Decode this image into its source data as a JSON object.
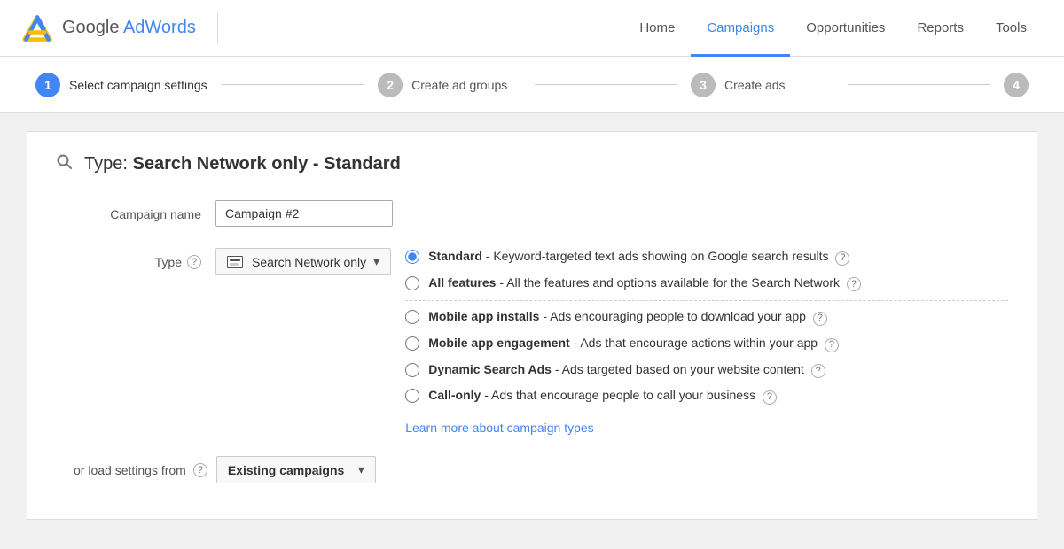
{
  "header": {
    "logo_text_regular": "Google ",
    "logo_text_blue": "AdWords",
    "nav_items": [
      {
        "id": "home",
        "label": "Home",
        "active": false
      },
      {
        "id": "campaigns",
        "label": "Campaigns",
        "active": true
      },
      {
        "id": "opportunities",
        "label": "Opportunities",
        "active": false
      },
      {
        "id": "reports",
        "label": "Reports",
        "active": false
      },
      {
        "id": "tools",
        "label": "Tools",
        "active": false
      }
    ]
  },
  "wizard": {
    "steps": [
      {
        "id": "select-settings",
        "number": "1",
        "label": "Select campaign settings",
        "active": true
      },
      {
        "id": "create-ad-groups",
        "number": "2",
        "label": "Create ad groups",
        "active": false
      },
      {
        "id": "create-ads",
        "number": "3",
        "label": "Create ads",
        "active": false
      },
      {
        "id": "step4",
        "number": "4",
        "label": "",
        "active": false
      }
    ]
  },
  "main": {
    "type_label": "Type:",
    "type_value": "Search Network only - Standard",
    "campaign_name_label": "Campaign name",
    "campaign_name_value": "Campaign #2",
    "type_field_label": "Type",
    "network_dropdown_label": "Search Network only",
    "radio_options": [
      {
        "id": "standard",
        "checked": true,
        "bold": "Standard",
        "desc": " - Keyword-targeted text ads showing on Google search results",
        "has_help": true
      },
      {
        "id": "all-features",
        "checked": false,
        "bold": "All features",
        "desc": " - All the features and options available for the Search Network",
        "has_help": true
      },
      {
        "id": "mobile-installs",
        "checked": false,
        "bold": "Mobile app installs",
        "desc": " - Ads encouraging people to download your app",
        "has_help": true
      },
      {
        "id": "mobile-engagement",
        "checked": false,
        "bold": "Mobile app engagement",
        "desc": " - Ads that encourage actions within your app",
        "has_help": true
      },
      {
        "id": "dynamic-search",
        "checked": false,
        "bold": "Dynamic Search Ads",
        "desc": " - Ads targeted based on your website content",
        "has_help": true
      },
      {
        "id": "call-only",
        "checked": false,
        "bold": "Call-only",
        "desc": " - Ads that encourage people to call your business",
        "has_help": true
      }
    ],
    "learn_more_text": "Learn more about campaign types",
    "load_settings_label": "or load settings from",
    "existing_campaigns_label": "Existing campaigns"
  }
}
